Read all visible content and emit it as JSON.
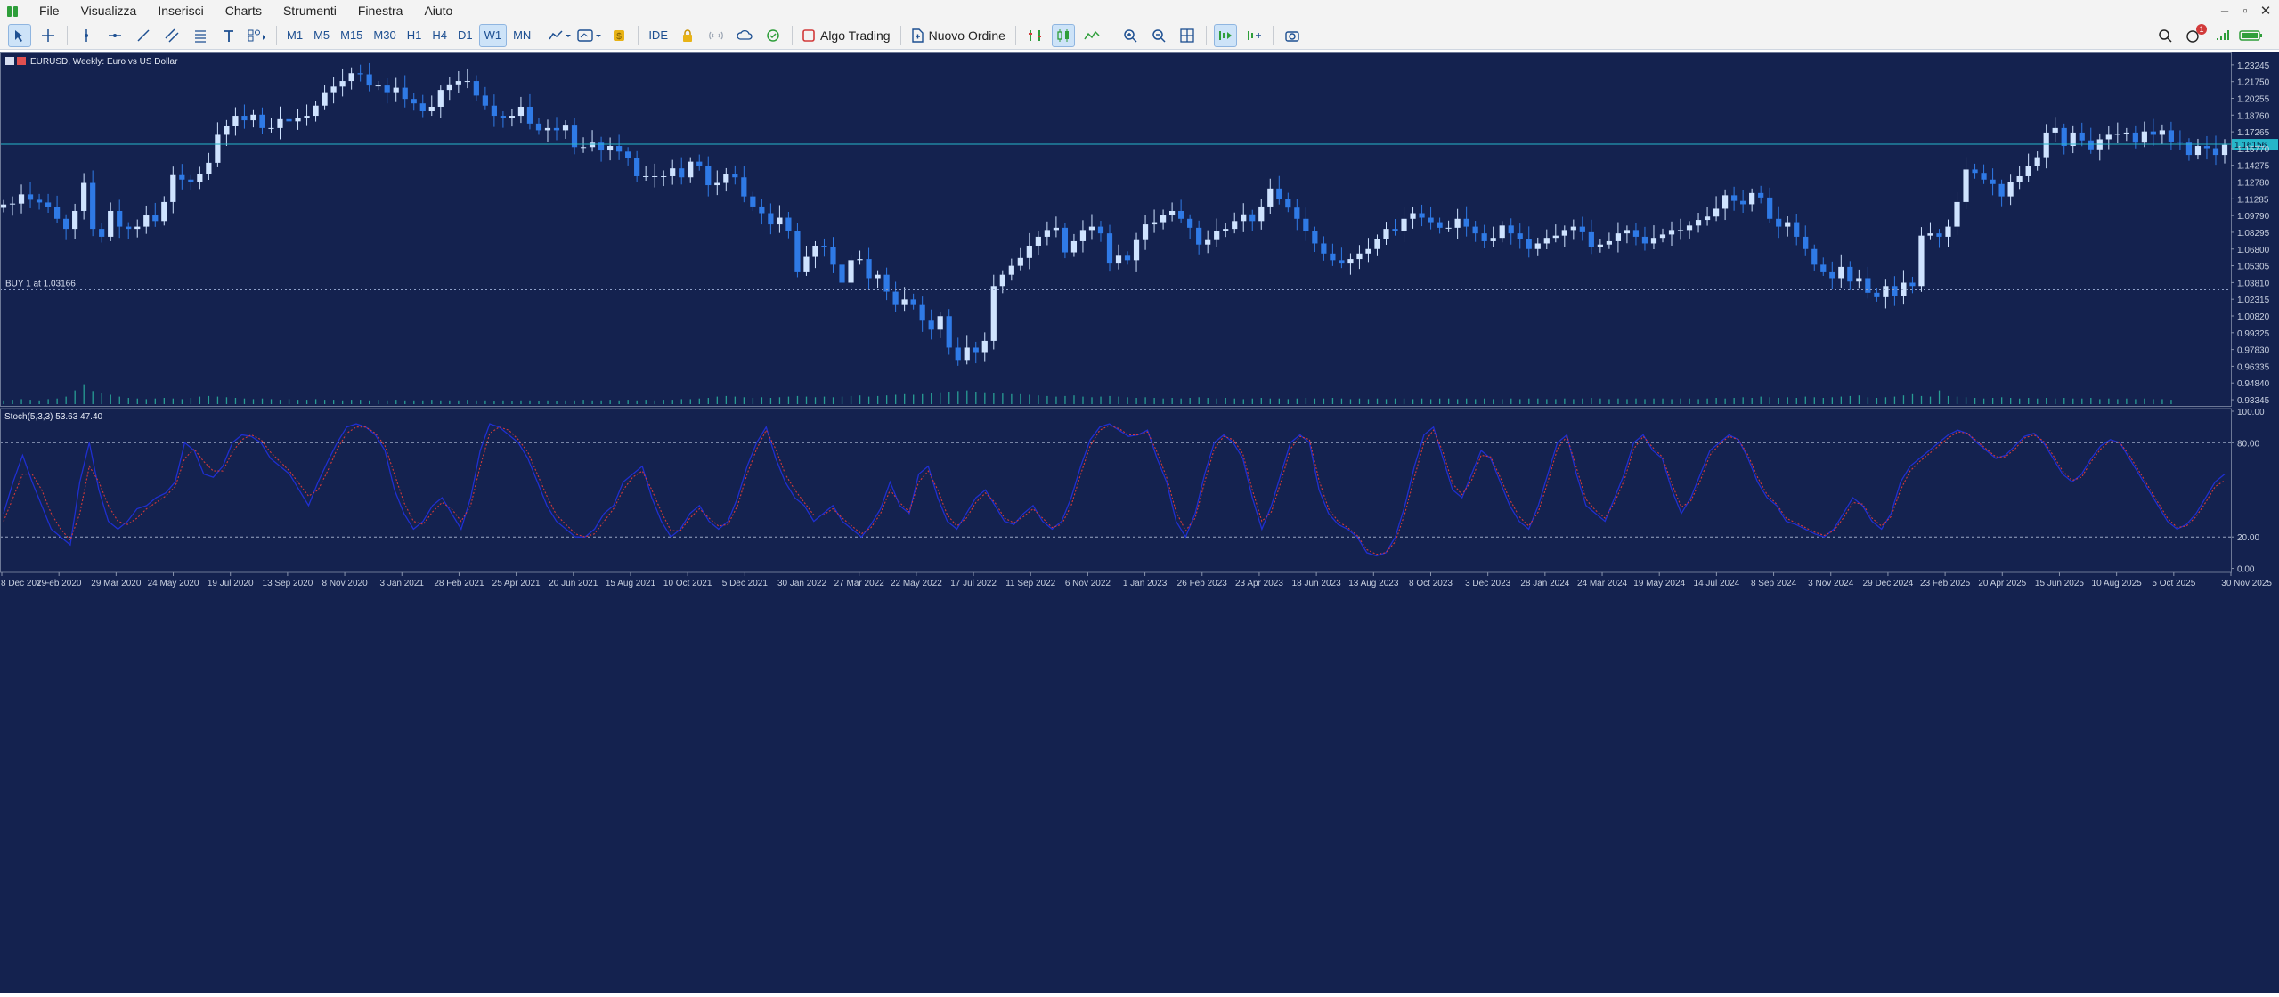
{
  "menu": {
    "items": [
      "File",
      "Visualizza",
      "Inserisci",
      "Charts",
      "Strumenti",
      "Finestra",
      "Aiuto"
    ]
  },
  "toolbar": {
    "timeframes": [
      "M1",
      "M5",
      "M15",
      "M30",
      "H1",
      "H4",
      "D1",
      "W1",
      "MN"
    ],
    "selected_timeframe": "W1",
    "ide_label": "IDE",
    "algo_trading_label": "Algo Trading",
    "new_order_label": "Nuovo Ordine",
    "notification_count": "1",
    "icons": [
      "cursor-icon",
      "crosshair-icon",
      "vertical-line-icon",
      "horizontal-line-icon",
      "trendline-icon",
      "channel-icon",
      "fibonacci-icon",
      "text-icon",
      "shapes-icon",
      "indicators-icon",
      "templates-icon",
      "gold-coin-icon",
      "lock-icon",
      "signal-icon",
      "cloud-icon",
      "market-icon",
      "depth-icon",
      "candles-icon",
      "line-chart-icon",
      "zoom-in-icon",
      "zoom-out-icon",
      "grid-icon",
      "autoscroll-icon",
      "chart-shift-icon",
      "screenshot-icon",
      "search-icon",
      "notifications-icon",
      "signal-strength-icon",
      "battery-icon"
    ]
  },
  "chart": {
    "title": "EURUSD, Weekly:  Euro vs US Dollar",
    "current_price": "1.16156",
    "buy_line_label": "BUY 1 at 1.03166",
    "buy_price": 1.03166,
    "price_axis_ticks": [
      "1.23245",
      "1.21750",
      "1.20255",
      "1.18760",
      "1.17265",
      "1.15770",
      "1.14275",
      "1.12780",
      "1.11285",
      "1.09790",
      "1.08295",
      "1.06800",
      "1.05305",
      "1.03810",
      "1.02315",
      "1.00820",
      "0.99325",
      "0.97830",
      "0.96335",
      "0.94840",
      "0.93345"
    ],
    "stoch_label": "Stoch(5,3,3) 53.63 47.40",
    "stoch_axis_ticks": [
      "100.00",
      "80.00",
      "20.00",
      "0.00"
    ],
    "date_axis_ticks": [
      "8 Dec 2019",
      "2 Feb 2020",
      "29 Mar 2020",
      "24 May 2020",
      "19 Jul 2020",
      "13 Sep 2020",
      "8 Nov 2020",
      "3 Jan 2021",
      "28 Feb 2021",
      "25 Apr 2021",
      "20 Jun 2021",
      "15 Aug 2021",
      "10 Oct 2021",
      "5 Dec 2021",
      "30 Jan 2022",
      "27 Mar 2022",
      "22 May 2022",
      "17 Jul 2022",
      "11 Sep 2022",
      "6 Nov 2022",
      "1 Jan 2023",
      "26 Feb 2023",
      "23 Apr 2023",
      "18 Jun 2023",
      "13 Aug 2023",
      "8 Oct 2023",
      "3 Dec 2023",
      "28 Jan 2024",
      "24 Mar 2024",
      "19 May 2024",
      "14 Jul 2024",
      "8 Sep 2024",
      "3 Nov 2024",
      "29 Dec 2024",
      "23 Feb 2025",
      "20 Apr 2025",
      "15 Jun 2025",
      "10 Aug 2025",
      "5 Oct 2025",
      "30 Nov 2025"
    ],
    "colors": {
      "background": "#14224f",
      "bull": "#cfe3ff",
      "bear": "#2f7ae6",
      "volume": "#2bb3a0",
      "current_price_line": "#26b6c9",
      "stoch_main": "#1f2fd0",
      "stoch_signal": "#d23a3a",
      "axis_text": "#c8d0e0"
    },
    "price_series": [
      1.1078,
      1.1086,
      1.1168,
      1.112,
      1.1096,
      1.1056,
      1.095,
      1.086,
      1.102,
      1.127,
      1.086,
      1.079,
      1.102,
      1.088,
      1.086,
      1.088,
      1.098,
      1.093,
      1.11,
      1.134,
      1.13,
      1.128,
      1.135,
      1.145,
      1.17,
      1.178,
      1.187,
      1.183,
      1.188,
      1.176,
      1.176,
      1.184,
      1.182,
      1.185,
      1.187,
      1.196,
      1.208,
      1.213,
      1.218,
      1.225,
      1.224,
      1.214,
      1.214,
      1.208,
      1.212,
      1.202,
      1.198,
      1.191,
      1.195,
      1.21,
      1.215,
      1.218,
      1.218,
      1.205,
      1.196,
      1.187,
      1.185,
      1.187,
      1.195,
      1.18,
      1.174,
      1.176,
      1.174,
      1.179,
      1.159,
      1.159,
      1.163,
      1.156,
      1.16,
      1.155,
      1.149,
      1.133,
      1.133,
      1.133,
      1.133,
      1.14,
      1.132,
      1.146,
      1.142,
      1.125,
      1.127,
      1.135,
      1.132,
      1.115,
      1.106,
      1.1,
      1.09,
      1.096,
      1.084,
      1.048,
      1.061,
      1.071,
      1.07,
      1.054,
      1.038,
      1.058,
      1.059,
      1.042,
      1.045,
      1.03,
      1.018,
      1.023,
      1.018,
      1.004,
      0.996,
      1.008,
      0.98,
      0.969,
      0.98,
      0.976,
      0.986,
      1.035,
      1.045,
      1.053,
      1.06,
      1.071,
      1.079,
      1.085,
      1.087,
      1.065,
      1.075,
      1.085,
      1.088,
      1.082,
      1.055,
      1.062,
      1.058,
      1.076,
      1.09,
      1.092,
      1.098,
      1.102,
      1.095,
      1.087,
      1.072,
      1.076,
      1.084,
      1.086,
      1.093,
      1.099,
      1.093,
      1.106,
      1.122,
      1.113,
      1.105,
      1.095,
      1.084,
      1.073,
      1.064,
      1.058,
      1.055,
      1.059,
      1.064,
      1.068,
      1.077,
      1.086,
      1.084,
      1.095,
      1.1,
      1.096,
      1.092,
      1.087,
      1.087,
      1.095,
      1.088,
      1.082,
      1.075,
      1.078,
      1.089,
      1.082,
      1.077,
      1.068,
      1.073,
      1.078,
      1.08,
      1.085,
      1.088,
      1.083,
      1.07,
      1.072,
      1.075,
      1.082,
      1.085,
      1.079,
      1.073,
      1.078,
      1.081,
      1.085,
      1.085,
      1.089,
      1.094,
      1.097,
      1.104,
      1.116,
      1.111,
      1.108,
      1.118,
      1.114,
      1.095,
      1.088,
      1.092,
      1.079,
      1.068,
      1.054,
      1.048,
      1.042,
      1.052,
      1.039,
      1.042,
      1.029,
      1.025,
      1.035,
      1.026,
      1.038,
      1.035,
      1.08,
      1.082,
      1.079,
      1.088,
      1.11,
      1.139,
      1.136,
      1.13,
      1.126,
      1.115,
      1.128,
      1.133,
      1.142,
      1.15,
      1.172,
      1.176,
      1.16,
      1.172,
      1.165,
      1.157,
      1.166,
      1.17,
      1.171,
      1.172,
      1.163,
      1.173,
      1.17,
      1.174,
      1.164,
      1.163,
      1.152,
      1.16,
      1.158,
      1.152,
      1.161
    ],
    "volume_series": [
      0.06,
      0.07,
      0.08,
      0.07,
      0.06,
      0.08,
      0.09,
      0.12,
      0.22,
      0.32,
      0.21,
      0.18,
      0.15,
      0.12,
      0.1,
      0.09,
      0.08,
      0.09,
      0.1,
      0.09,
      0.08,
      0.1,
      0.12,
      0.13,
      0.12,
      0.11,
      0.1,
      0.09,
      0.08,
      0.09,
      0.08,
      0.07,
      0.08,
      0.07,
      0.07,
      0.08,
      0.07,
      0.07,
      0.06,
      0.07,
      0.07,
      0.06,
      0.07,
      0.06,
      0.07,
      0.06,
      0.06,
      0.06,
      0.07,
      0.06,
      0.06,
      0.06,
      0.07,
      0.06,
      0.06,
      0.05,
      0.06,
      0.05,
      0.06,
      0.06,
      0.05,
      0.06,
      0.05,
      0.06,
      0.06,
      0.07,
      0.06,
      0.06,
      0.07,
      0.06,
      0.07,
      0.06,
      0.07,
      0.06,
      0.07,
      0.07,
      0.08,
      0.08,
      0.09,
      0.1,
      0.12,
      0.13,
      0.12,
      0.11,
      0.1,
      0.11,
      0.1,
      0.11,
      0.12,
      0.13,
      0.12,
      0.11,
      0.12,
      0.11,
      0.12,
      0.13,
      0.14,
      0.12,
      0.13,
      0.14,
      0.15,
      0.16,
      0.15,
      0.16,
      0.18,
      0.19,
      0.2,
      0.21,
      0.22,
      0.2,
      0.19,
      0.18,
      0.17,
      0.16,
      0.16,
      0.15,
      0.14,
      0.13,
      0.12,
      0.13,
      0.14,
      0.12,
      0.11,
      0.12,
      0.13,
      0.12,
      0.11,
      0.1,
      0.11,
      0.1,
      0.09,
      0.1,
      0.09,
      0.1,
      0.11,
      0.1,
      0.09,
      0.1,
      0.09,
      0.08,
      0.09,
      0.1,
      0.09,
      0.09,
      0.08,
      0.09,
      0.1,
      0.09,
      0.09,
      0.1,
      0.09,
      0.08,
      0.09,
      0.08,
      0.09,
      0.08,
      0.09,
      0.09,
      0.08,
      0.09,
      0.08,
      0.09,
      0.09,
      0.08,
      0.09,
      0.08,
      0.09,
      0.08,
      0.08,
      0.09,
      0.08,
      0.09,
      0.09,
      0.08,
      0.08,
      0.09,
      0.08,
      0.09,
      0.1,
      0.09,
      0.08,
      0.09,
      0.08,
      0.09,
      0.08,
      0.09,
      0.09,
      0.08,
      0.09,
      0.09,
      0.08,
      0.09,
      0.1,
      0.09,
      0.1,
      0.11,
      0.1,
      0.12,
      0.11,
      0.1,
      0.11,
      0.1,
      0.12,
      0.11,
      0.1,
      0.11,
      0.12,
      0.13,
      0.14,
      0.11,
      0.1,
      0.11,
      0.12,
      0.14,
      0.16,
      0.13,
      0.12,
      0.22,
      0.13,
      0.12,
      0.11,
      0.1,
      0.09,
      0.1,
      0.11,
      0.1,
      0.09,
      0.1,
      0.09,
      0.1,
      0.09,
      0.1,
      0.09,
      0.09,
      0.1,
      0.08,
      0.09,
      0.08,
      0.09,
      0.08,
      0.09,
      0.08,
      0.08,
      0.07
    ],
    "stoch_main": [
      35,
      55,
      72,
      55,
      40,
      25,
      20,
      15,
      55,
      80,
      50,
      30,
      25,
      30,
      38,
      40,
      45,
      48,
      55,
      80,
      75,
      60,
      58,
      65,
      80,
      85,
      84,
      80,
      70,
      65,
      60,
      50,
      40,
      55,
      68,
      80,
      90,
      92,
      90,
      85,
      75,
      50,
      35,
      25,
      30,
      40,
      45,
      35,
      25,
      45,
      75,
      92,
      90,
      85,
      80,
      70,
      55,
      40,
      30,
      25,
      20,
      20,
      25,
      35,
      40,
      55,
      60,
      65,
      45,
      30,
      20,
      25,
      35,
      40,
      30,
      25,
      30,
      45,
      65,
      80,
      90,
      70,
      55,
      45,
      40,
      30,
      35,
      40,
      30,
      25,
      20,
      28,
      38,
      55,
      40,
      35,
      60,
      65,
      45,
      30,
      25,
      35,
      45,
      50,
      40,
      30,
      28,
      35,
      40,
      30,
      25,
      30,
      45,
      65,
      82,
      90,
      92,
      88,
      84,
      85,
      88,
      70,
      55,
      30,
      20,
      35,
      60,
      80,
      85,
      80,
      70,
      45,
      25,
      40,
      60,
      80,
      85,
      80,
      50,
      35,
      28,
      25,
      20,
      10,
      8,
      10,
      20,
      40,
      65,
      85,
      90,
      70,
      50,
      45,
      60,
      75,
      70,
      55,
      40,
      30,
      25,
      40,
      60,
      80,
      85,
      60,
      40,
      35,
      30,
      45,
      60,
      80,
      85,
      75,
      70,
      50,
      35,
      45,
      60,
      75,
      80,
      85,
      82,
      70,
      55,
      45,
      40,
      30,
      28,
      25,
      22,
      20,
      25,
      35,
      45,
      40,
      30,
      25,
      35,
      55,
      65,
      70,
      75,
      80,
      85,
      88,
      86,
      80,
      75,
      70,
      72,
      78,
      84,
      86,
      80,
      70,
      60,
      55,
      60,
      70,
      78,
      82,
      80,
      70,
      60,
      50,
      40,
      30,
      25,
      28,
      35,
      45,
      55,
      60
    ],
    "stoch_signal": [
      30,
      45,
      60,
      60,
      50,
      35,
      25,
      18,
      35,
      65,
      55,
      40,
      30,
      28,
      32,
      38,
      42,
      46,
      52,
      70,
      76,
      68,
      62,
      62,
      74,
      82,
      85,
      82,
      74,
      68,
      62,
      54,
      46,
      50,
      62,
      76,
      86,
      90,
      90,
      86,
      78,
      60,
      42,
      30,
      28,
      36,
      42,
      38,
      30,
      40,
      65,
      86,
      90,
      88,
      82,
      74,
      60,
      46,
      34,
      28,
      22,
      20,
      22,
      30,
      38,
      50,
      58,
      62,
      50,
      36,
      24,
      24,
      32,
      38,
      32,
      27,
      28,
      40,
      60,
      76,
      88,
      76,
      60,
      50,
      42,
      34,
      34,
      38,
      32,
      27,
      22,
      26,
      35,
      50,
      42,
      36,
      55,
      62,
      50,
      34,
      27,
      32,
      42,
      48,
      42,
      32,
      29,
      33,
      38,
      32,
      26,
      28,
      40,
      60,
      78,
      88,
      91,
      89,
      85,
      85,
      87,
      74,
      58,
      36,
      24,
      32,
      55,
      76,
      84,
      82,
      73,
      50,
      30,
      36,
      55,
      76,
      84,
      82,
      56,
      38,
      30,
      26,
      21,
      12,
      9,
      10,
      17,
      35,
      58,
      80,
      88,
      74,
      54,
      47,
      56,
      72,
      71,
      58,
      44,
      33,
      27,
      36,
      55,
      76,
      84,
      64,
      44,
      37,
      32,
      42,
      56,
      76,
      84,
      77,
      71,
      54,
      39,
      43,
      56,
      72,
      79,
      84,
      82,
      72,
      58,
      47,
      41,
      32,
      29,
      26,
      23,
      21,
      24,
      32,
      42,
      41,
      32,
      27,
      33,
      50,
      62,
      68,
      73,
      78,
      83,
      87,
      86,
      81,
      76,
      71,
      71,
      76,
      83,
      85,
      81,
      72,
      62,
      56,
      58,
      68,
      76,
      81,
      80,
      72,
      62,
      52,
      42,
      32,
      26,
      27,
      33,
      42,
      52,
      56
    ]
  }
}
